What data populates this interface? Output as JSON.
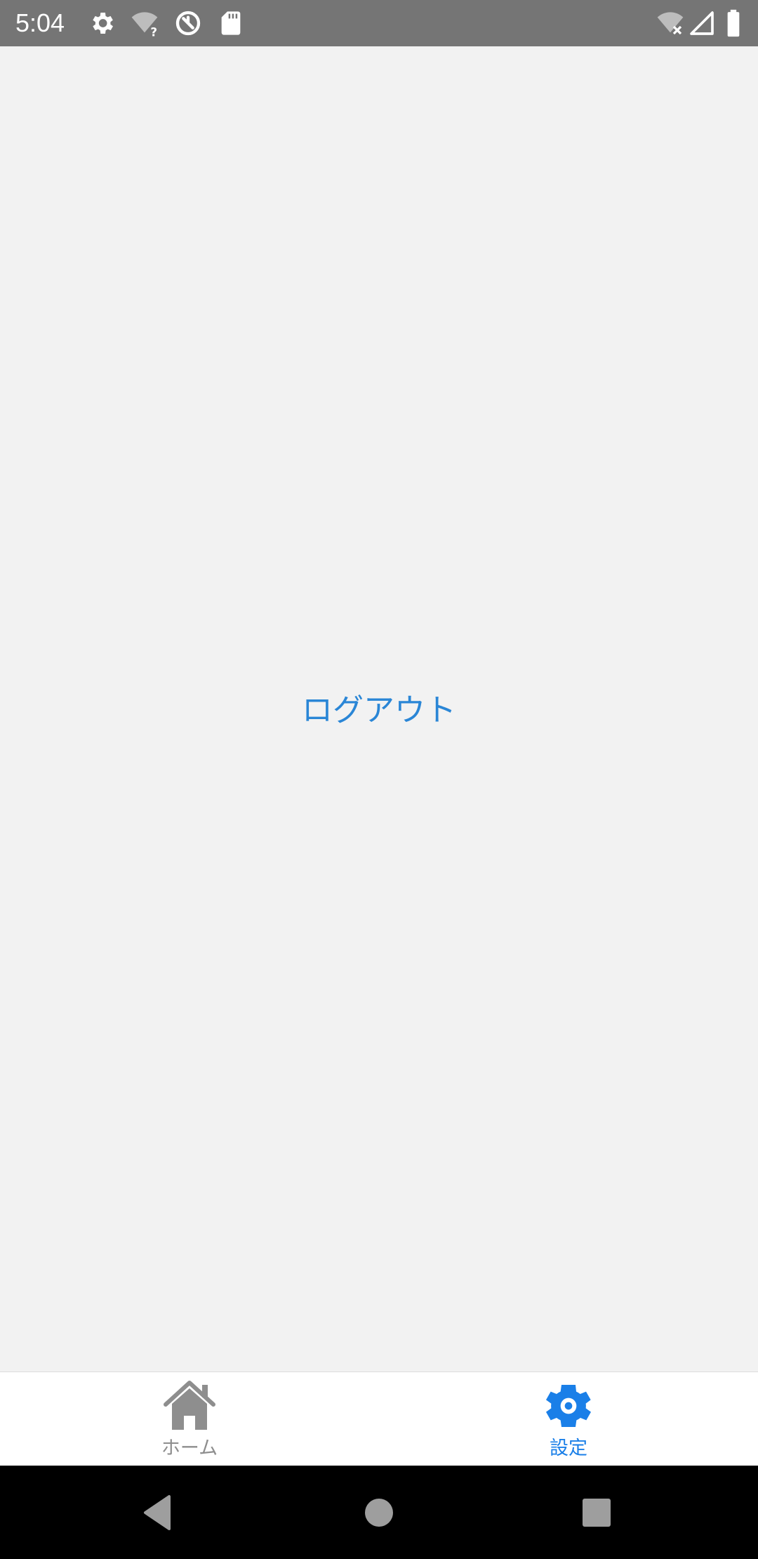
{
  "status_bar": {
    "time": "5:04",
    "icons": [
      "settings-icon",
      "wifi-unknown-icon",
      "data-saver-icon",
      "sd-card-icon",
      "wifi-off-icon",
      "signal-icon",
      "battery-icon"
    ]
  },
  "main": {
    "logout_label": "ログアウト",
    "accent_color": "#2a86d6"
  },
  "tab_bar": {
    "tabs": [
      {
        "label": "ホーム",
        "icon": "home-icon",
        "active": false
      },
      {
        "label": "設定",
        "icon": "gear-icon",
        "active": true
      }
    ],
    "active_color": "#1a7fe8",
    "inactive_color": "#8e8e8e"
  },
  "nav_bar": {
    "buttons": [
      "back-icon",
      "home-circle-icon",
      "recents-icon"
    ]
  }
}
